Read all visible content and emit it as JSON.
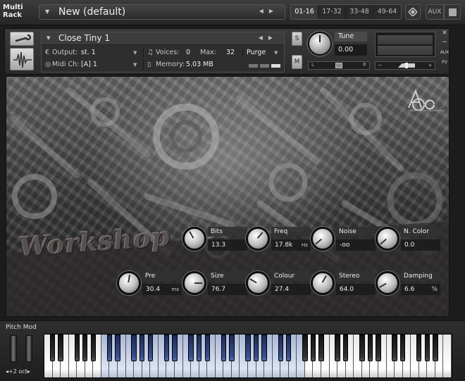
{
  "rack": {
    "logo_line1": "Multi",
    "logo_line2": "Rack",
    "title": "New (default)",
    "tabs": [
      "01-16",
      "17-32",
      "33-48",
      "49-64"
    ],
    "aux_label": "AUX"
  },
  "instrument": {
    "name": "Close Tiny 1",
    "output_label": "Output:",
    "output_value": "st. 1",
    "voices_label": "Voices:",
    "voices_value": "0",
    "max_label": "Max:",
    "max_value": "32",
    "purge_label": "Purge",
    "midi_label": "Midi Ch:",
    "midi_value": "[A]  1",
    "memory_label": "Memory:",
    "memory_value": "5.03 MB",
    "solo_label": "S",
    "mute_label": "M",
    "tune_label": "Tune",
    "tune_value": "0.00",
    "pan_left": "L",
    "pan_right": "R",
    "aux_small": "AUX",
    "pv_small": "PV"
  },
  "panel": {
    "title": "Workshop",
    "controls": [
      {
        "id": "bits",
        "label": "Bits",
        "value": "13.3",
        "unit": ""
      },
      {
        "id": "freq",
        "label": "Freq",
        "value": "17.8k",
        "unit": "Hz"
      },
      {
        "id": "noise",
        "label": "Noise",
        "value": "-oo",
        "unit": ""
      },
      {
        "id": "ncolor",
        "label": "N. Color",
        "value": "0.0",
        "unit": ""
      },
      {
        "id": "pre",
        "label": "Pre",
        "value": "30.4",
        "unit": "ms"
      },
      {
        "id": "size",
        "label": "Size",
        "value": "76.7",
        "unit": ""
      },
      {
        "id": "colour",
        "label": "Colour",
        "value": "27.4",
        "unit": ""
      },
      {
        "id": "stereo",
        "label": "Stereo",
        "value": "64.0",
        "unit": ""
      },
      {
        "id": "damping",
        "label": "Damping",
        "value": "6.6",
        "unit": "%"
      }
    ]
  },
  "keyboard": {
    "pitch_mod_label": "Pitch Mod",
    "octave_label": "+2 oct"
  }
}
